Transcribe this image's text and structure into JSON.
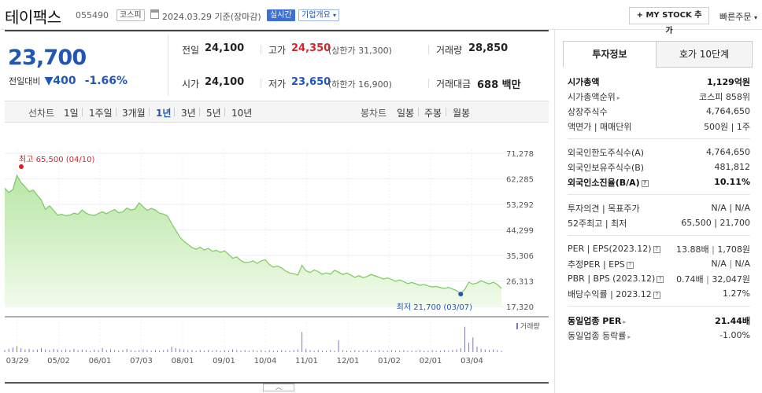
{
  "header": {
    "name": "테이팩스",
    "code": "055490",
    "market": "코스피",
    "date": "2024.03.29 기준(장마감)",
    "realtime_label": "실시간",
    "company_label": "기업개요",
    "mystock_label": "+ MY STOCK 추가",
    "quick_order_label": "빠른주문"
  },
  "quote": {
    "price": "23,700",
    "change_label": "전일대비",
    "change": "400",
    "change_pct": "-1.66%",
    "prev_label": "전일",
    "prev": "24,100",
    "high_label": "고가",
    "high": "24,350",
    "upper_limit": "(상한가 31,300)",
    "volume_label": "거래량",
    "volume": "28,850",
    "open_label": "시가",
    "open": "24,100",
    "low_label": "저가",
    "low": "23,650",
    "lower_limit": "(하한가 16,900)",
    "amount_label": "거래대금",
    "amount": "688 백만"
  },
  "periods": {
    "line_label": "선차트",
    "items": [
      "1일",
      "1주일",
      "3개월",
      "1년",
      "3년",
      "5년",
      "10년"
    ],
    "active": "1년",
    "candle_label": "봉차트",
    "candle_items": [
      "일봉",
      "주봉",
      "월봉"
    ]
  },
  "chart_data": {
    "type": "area",
    "y_ticks": [
      "71,278",
      "62,285",
      "53,292",
      "44,299",
      "35,306",
      "26,313",
      "17,320"
    ],
    "ylim": [
      17320,
      71278
    ],
    "x_ticks": [
      "03/29",
      "05/02",
      "06/01",
      "07/03",
      "08/01",
      "09/01",
      "10/04",
      "11/01",
      "12/01",
      "01/02",
      "02/01",
      "03/04"
    ],
    "high_annotation": "최고 65,500 (04/10)",
    "low_annotation": "최저 21,700 (03/07)",
    "volume_label": "거래량",
    "high_point": {
      "index": 3,
      "value": 65500
    },
    "low_point": {
      "index": 112,
      "value": 21700
    },
    "values": [
      59000,
      57500,
      58500,
      63500,
      61000,
      59500,
      57800,
      58300,
      56500,
      54800,
      51500,
      52800,
      51200,
      49500,
      49800,
      49300,
      49500,
      50200,
      49800,
      51300,
      50200,
      49600,
      49400,
      50100,
      50700,
      50000,
      50800,
      51500,
      50300,
      50700,
      52000,
      51300,
      51700,
      53800,
      52500,
      51200,
      51900,
      51300,
      50200,
      49900,
      49100,
      46500,
      44200,
      41800,
      40300,
      39200,
      38100,
      37500,
      38200,
      37200,
      37800,
      36800,
      37100,
      36400,
      36900,
      35700,
      34300,
      34800,
      33500,
      32800,
      32900,
      33400,
      32500,
      33400,
      33800,
      32100,
      31200,
      31600,
      30900,
      29800,
      29100,
      28900,
      28400,
      31800,
      29900,
      29300,
      30200,
      29600,
      28700,
      29200,
      28700,
      30100,
      29400,
      28600,
      29100,
      28400,
      27600,
      28200,
      27500,
      27900,
      28600,
      28100,
      27600,
      27000,
      27400,
      26900,
      26200,
      26700,
      26100,
      25400,
      25800,
      25300,
      24800,
      25100,
      24600,
      24200,
      24400,
      24000,
      23700,
      24100,
      23500,
      22900,
      21700,
      23400,
      25900,
      25200,
      25600,
      26400,
      25800,
      25300,
      25900,
      25100,
      23700
    ],
    "volume": [
      3,
      5,
      7,
      9,
      6,
      4,
      5,
      3,
      4,
      6,
      4,
      3,
      5,
      4,
      3,
      4,
      3,
      5,
      3,
      4,
      3,
      2,
      4,
      3,
      6,
      3,
      4,
      3,
      2,
      3,
      5,
      3,
      2,
      3,
      4,
      3,
      2,
      3,
      2,
      3,
      4,
      8,
      6,
      5,
      4,
      3,
      3,
      2,
      3,
      2,
      3,
      2,
      3,
      2,
      3,
      2,
      4,
      3,
      2,
      3,
      2,
      3,
      2,
      3,
      2,
      3,
      2,
      2,
      3,
      2,
      2,
      3,
      4,
      30,
      5,
      3,
      2,
      3,
      2,
      2,
      3,
      2,
      18,
      3,
      2,
      2,
      3,
      2,
      2,
      3,
      2,
      2,
      3,
      2,
      2,
      3,
      2,
      2,
      3,
      2,
      2,
      2,
      3,
      2,
      2,
      3,
      2,
      2,
      3,
      2,
      3,
      4,
      6,
      38,
      14,
      22,
      8,
      5,
      4,
      3,
      4,
      3,
      2
    ]
  },
  "side": {
    "tab_info": "투자정보",
    "tab_hoga": "호가 10단계",
    "rows1": [
      {
        "l": "시가총액",
        "v": "1,129억원"
      },
      {
        "l": "시가총액순위",
        "v": "코스피 858위"
      },
      {
        "l": "상장주식수",
        "v": "4,764,650"
      },
      {
        "l": "액면가 | 매매단위",
        "v": "500원 | 1주"
      }
    ],
    "rows2": [
      {
        "l": "외국인한도주식수(A)",
        "v": "4,764,650"
      },
      {
        "l": "외국인보유주식수(B)",
        "v": "481,812"
      },
      {
        "l": "외국인소진율(B/A)",
        "v": "10.11%"
      }
    ],
    "rows3": [
      {
        "l": "투자의견 | 목표주가",
        "v": "N/A | N/A"
      },
      {
        "l": "52주최고 | 최저",
        "v": "65,500 | 21,700"
      }
    ],
    "rows4": [
      {
        "l": "PER | EPS(2023.12)",
        "v1": "13.88배",
        "v2": "1,708원"
      },
      {
        "l": "추정PER | EPS",
        "v1": "N/A",
        "v2": "N/A"
      },
      {
        "l": "PBR | BPS (2023.12)",
        "v1": "0.74배",
        "v2": "32,047원"
      },
      {
        "l": "배당수익률 | 2023.12",
        "v2": "1.27%"
      }
    ],
    "rows5": [
      {
        "l": "동일업종 PER",
        "v": "21.44배"
      },
      {
        "l": "동일업종 등락률",
        "v": "-1.00%"
      }
    ]
  }
}
